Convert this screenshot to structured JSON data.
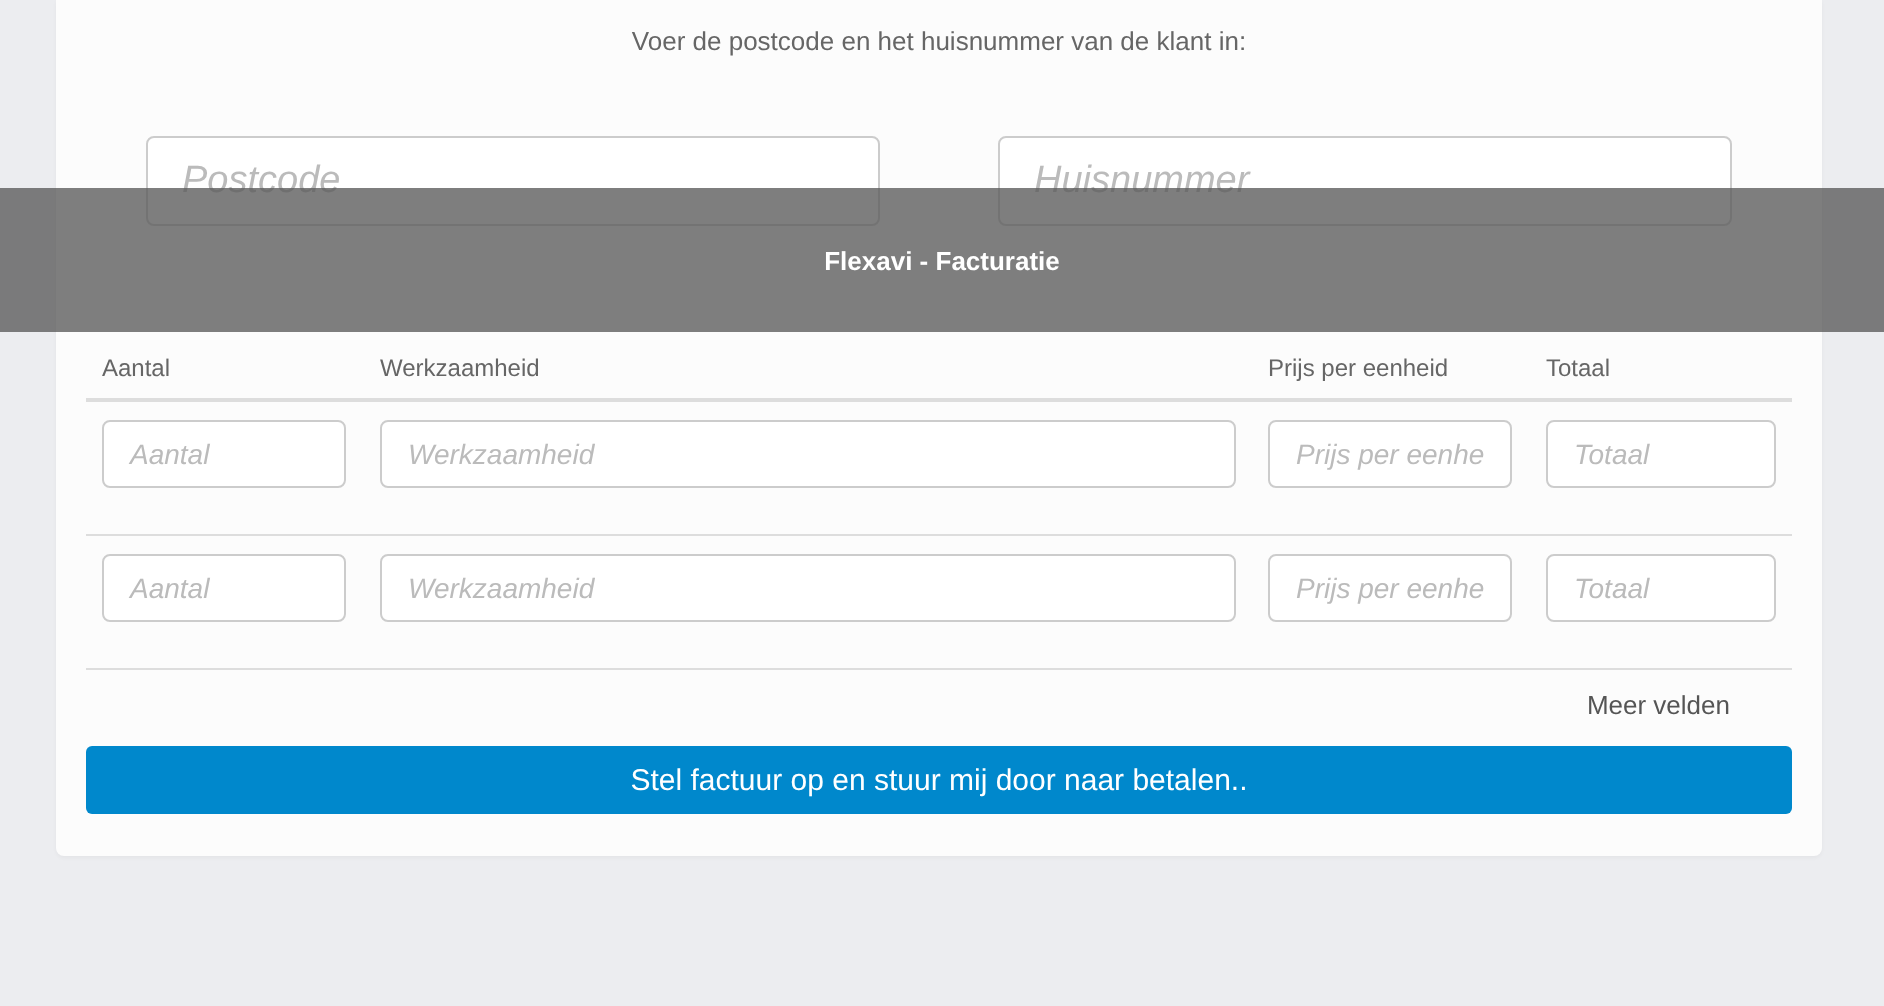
{
  "instruction": "Voer de postcode en het huisnummer van de klant in:",
  "address_fields": [
    {
      "placeholder": "Postcode"
    },
    {
      "placeholder": "Huisnummer"
    }
  ],
  "overlay": {
    "title": "Flexavi - Facturatie"
  },
  "table": {
    "columns": [
      "Aantal",
      "Werkzaamheid",
      "Prijs per eenheid",
      "Totaal"
    ],
    "rows": [
      {
        "cells": [
          {
            "placeholder": "Aantal"
          },
          {
            "placeholder": "Werkzaamheid"
          },
          {
            "placeholder": "Prijs per eenhe"
          },
          {
            "placeholder": "Totaal"
          }
        ]
      },
      {
        "cells": [
          {
            "placeholder": "Aantal"
          },
          {
            "placeholder": "Werkzaamheid"
          },
          {
            "placeholder": "Prijs per eenhe"
          },
          {
            "placeholder": "Totaal"
          }
        ]
      }
    ]
  },
  "more_link": "Meer velden",
  "submit_button": "Stel factuur op en stuur mij door naar betalen.."
}
